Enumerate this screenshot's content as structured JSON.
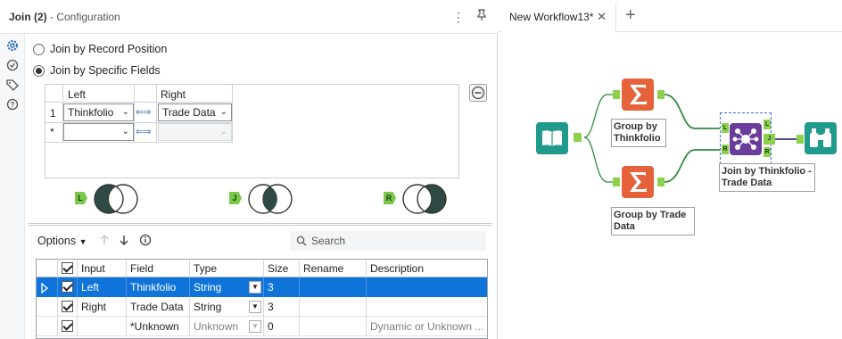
{
  "config": {
    "title": "Join (2)",
    "subtitle": "- Configuration",
    "radio_record_position": "Join by Record Position",
    "radio_specific_fields": "Join by Specific Fields",
    "join_grid": {
      "left_header": "Left",
      "right_header": "Right",
      "rows": [
        {
          "num": "1",
          "left": "Thinkfolio",
          "right": "Trade Data"
        },
        {
          "num": "*",
          "left": "",
          "right": ""
        }
      ]
    },
    "venn": [
      {
        "tag": "L",
        "name": "left-only"
      },
      {
        "tag": "J",
        "name": "join"
      },
      {
        "tag": "R",
        "name": "right-only"
      }
    ],
    "options_label": "Options",
    "search_placeholder": "Search",
    "table": {
      "columns": [
        "",
        "Input",
        "Field",
        "Type",
        "Size",
        "Rename",
        "Description"
      ],
      "rows": [
        {
          "input": "Left",
          "field": "Thinkfolio",
          "type": "String",
          "size": "3",
          "rename": "",
          "description": "",
          "selected": true
        },
        {
          "input": "Right",
          "field": "Trade Data",
          "type": "String",
          "size": "3",
          "rename": "",
          "description": "",
          "selected": false
        },
        {
          "input": "",
          "field": "*Unknown",
          "type": "Unknown",
          "size": "0",
          "rename": "",
          "description": "Dynamic or Unknown ...",
          "selected": false
        }
      ]
    }
  },
  "workflow": {
    "tab_label": "New Workflow13*",
    "tools": {
      "group_thinkfolio": "Group by Thinkfolio",
      "group_trade": "Group by Trade Data",
      "join": "Join by Thinkfolio - Trade Data"
    },
    "anchors": {
      "left": "L",
      "join": "J",
      "right": "R"
    }
  },
  "colors": {
    "selection_blue": "#0f74d9",
    "summarize_orange": "#e5623a",
    "input_teal": "#1f9a8d",
    "join_purple": "#6a3d9a",
    "connector_green": "#2f8c3e",
    "anchor_green": "#8bd14b"
  }
}
